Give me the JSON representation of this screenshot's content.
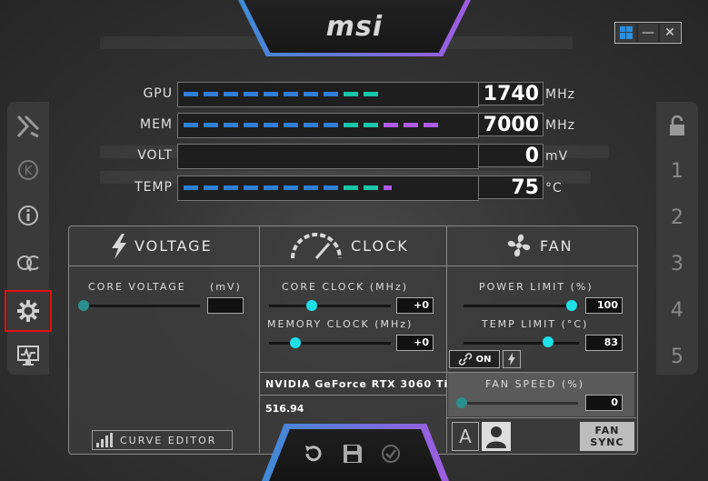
{
  "header": {
    "logo": "msi"
  },
  "window_controls": {
    "minimize": "—",
    "close": "✕"
  },
  "meters": [
    {
      "label": "GPU",
      "value": "1740",
      "unit": "MHz",
      "fill": 0.69
    },
    {
      "label": "MEM",
      "value": "7000",
      "unit": "MHz",
      "fill": 0.91
    },
    {
      "label": "VOLT",
      "value": "0",
      "unit": "mV",
      "fill": 0.0
    },
    {
      "label": "TEMP",
      "value": "75",
      "unit": "°C",
      "fill": 0.74
    }
  ],
  "left_sidebar": [
    {
      "name": "oc-scanner-icon"
    },
    {
      "name": "kombustor-icon"
    },
    {
      "name": "info-icon"
    },
    {
      "name": "oc-icon"
    },
    {
      "name": "settings-icon",
      "selected": true
    },
    {
      "name": "monitor-icon"
    }
  ],
  "right_sidebar": {
    "profiles": [
      "1",
      "2",
      "3",
      "4",
      "5"
    ]
  },
  "voltage": {
    "title": "VOLTAGE",
    "core_voltage_label": "CORE VOLTAGE",
    "core_voltage_unit": "(mV)",
    "core_voltage_value": "",
    "curve_editor": "CURVE EDITOR"
  },
  "clock": {
    "title": "CLOCK",
    "core_clock_label": "CORE CLOCK (MHz)",
    "core_clock_value": "+0",
    "memory_clock_label": "MEMORY CLOCK (MHz)",
    "memory_clock_value": "+0",
    "gpu_name": "NVIDIA GeForce RTX 3060 Ti",
    "driver_version": "516.94"
  },
  "fan": {
    "title": "FAN",
    "power_limit_label": "POWER LIMIT (%)",
    "power_limit_value": "100",
    "temp_limit_label": "TEMP LIMIT (°C)",
    "temp_limit_value": "83",
    "link_state": "ON",
    "fan_speed_label": "FAN SPEED (%)",
    "fan_speed_value": "0",
    "auto_label": "A",
    "fan_sync": "FAN SYNC"
  },
  "colors": {
    "accent_cyan": "#1de1e6",
    "bar_blue": "#2f7fd8",
    "bar_teal": "#18c6a8",
    "bar_purple": "#b05be8",
    "highlight_red": "#e01010"
  }
}
